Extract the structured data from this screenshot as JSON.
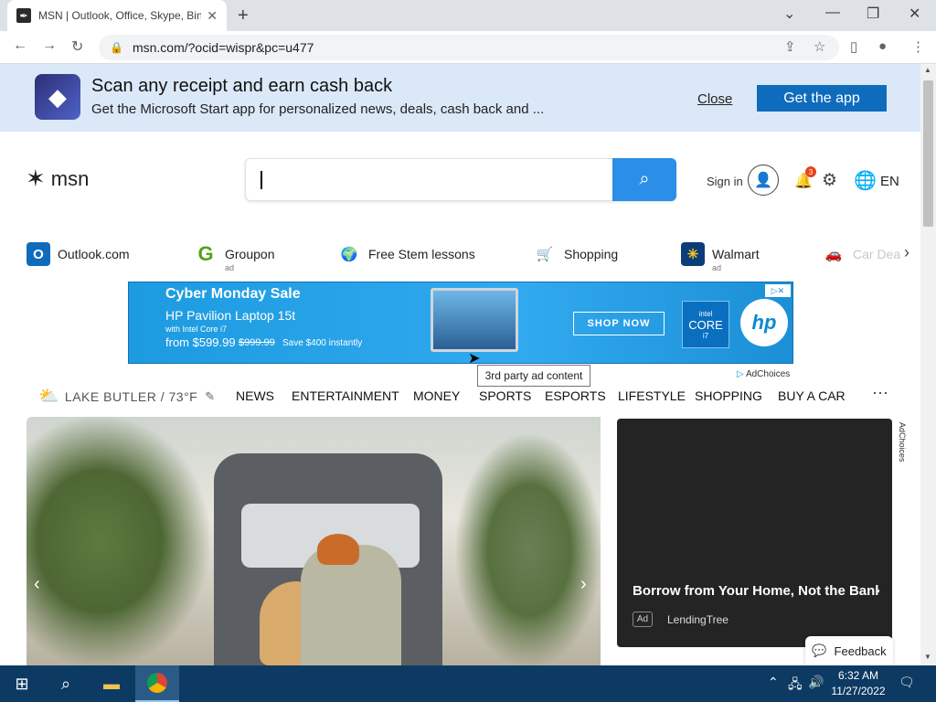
{
  "browser": {
    "tab_title": "MSN | Outlook, Office, Skype, Bing",
    "new_tab": "+",
    "url": "msn.com/?ocid=wispr&pc=u477"
  },
  "promo": {
    "headline": "Scan any receipt and earn cash back",
    "subline": "Get the Microsoft Start app for personalized news, deals, cash back and ...",
    "close_label": "Close",
    "cta_label": "Get the app"
  },
  "header": {
    "brand": "msn",
    "signin_label": "Sign in",
    "notification_count": "3",
    "language": "EN"
  },
  "quick_links": [
    {
      "label": "Outlook.com",
      "ad": "",
      "icon": "outlook-icon",
      "color": "#0f6cbd"
    },
    {
      "label": "Groupon",
      "ad": "ad",
      "icon": "groupon-icon",
      "color": "#53a318"
    },
    {
      "label": "Free Stem lessons",
      "ad": "",
      "icon": "globe-icon",
      "color": "#4a8a5c"
    },
    {
      "label": "Shopping",
      "ad": "",
      "icon": "cart-icon",
      "color": "#1e6fd9"
    },
    {
      "label": "Walmart",
      "ad": "ad",
      "icon": "walmart-icon",
      "color": "#0a3d7a"
    },
    {
      "label": "Car Dea",
      "ad": "",
      "icon": "car-icon",
      "color": "#8db4d9"
    }
  ],
  "ad_banner": {
    "title": "Cyber Monday Sale",
    "product": "HP Pavilion Laptop 15t",
    "processor": "with Intel Core i7",
    "price": "from $599.99",
    "old_price": "$999.99",
    "savings": "Save $400 instantly",
    "cta": "SHOP NOW",
    "intel_brand": "intel",
    "intel_line": "CORE",
    "intel_tier": "i7",
    "hp_logo": "hp"
  },
  "tooltip": "3rd party ad content",
  "adchoices": "AdChoices",
  "weather": {
    "location": "LAKE BUTLER / 73°F"
  },
  "categories": [
    "NEWS",
    "ENTERTAINMENT",
    "MONEY",
    "SPORTS",
    "ESPORTS",
    "LIFESTYLE",
    "SHOPPING",
    "BUY A CAR"
  ],
  "more_label": "···",
  "side_ad": {
    "headline": "Borrow from Your Home, Not the Bank",
    "ad_label": "Ad",
    "sponsor": "LendingTree"
  },
  "feedback_label": "Feedback",
  "clock": {
    "time": "6:32 AM",
    "date": "11/27/2022"
  }
}
